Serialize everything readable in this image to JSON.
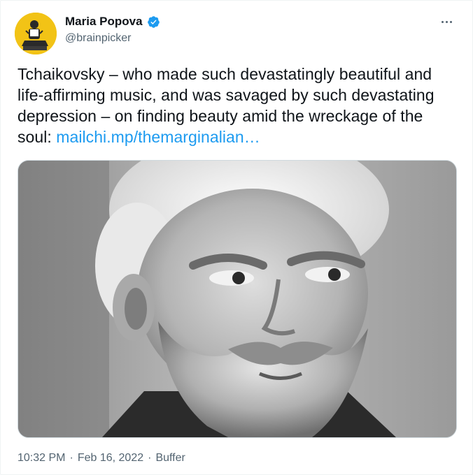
{
  "author": {
    "name": "Maria Popova",
    "handle": "@brainpicker",
    "verified_icon": "verified-badge-icon",
    "accent_color": "#1d9bf0"
  },
  "tweet": {
    "text": "Tchaikovsky – who made such devastatingly beautiful and life-affirming music, and was savaged by such devastating depression – on finding beauty amid the wreckage of the soul: ",
    "link_text": "mailchi.mp/themarginalian…"
  },
  "media": {
    "icon": "portrait-photo-icon"
  },
  "meta": {
    "time": "10:32 PM",
    "date": "Feb 16, 2022",
    "source": "Buffer",
    "separator": "·"
  },
  "menu": {
    "icon": "more-options-icon"
  }
}
